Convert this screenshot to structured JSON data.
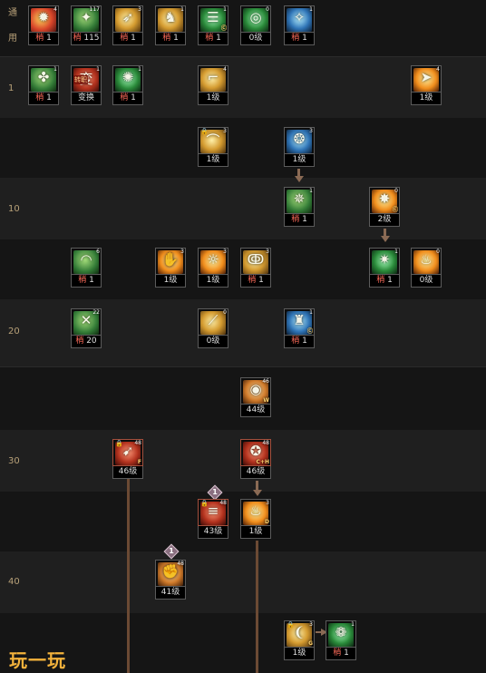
{
  "rows": [
    {
      "label": "通\n用",
      "vertical": true
    },
    {
      "label": "1"
    },
    {
      "label": ""
    },
    {
      "label": "10"
    },
    {
      "label": ""
    },
    {
      "label": "20"
    },
    {
      "label": ""
    },
    {
      "label": "30"
    },
    {
      "label": ""
    },
    {
      "label": "40"
    },
    {
      "label": ""
    }
  ],
  "skills": [
    {
      "name": "skill-fire-burst",
      "glyph": "✹",
      "grad": "g1",
      "count": "4",
      "red": "稍",
      "rest": " 1"
    },
    {
      "name": "skill-green-strike",
      "glyph": "✦",
      "grad": "g2",
      "count": "117",
      "red": "稍",
      "rest": " 115"
    },
    {
      "name": "skill-golden-leap",
      "glyph": "➶",
      "grad": "g3",
      "count": "3",
      "red": "稍",
      "rest": " 1"
    },
    {
      "name": "skill-golden-fall",
      "glyph": "♞",
      "grad": "g3",
      "count": "1",
      "red": "稍",
      "rest": " 1"
    },
    {
      "name": "skill-green-cloud",
      "glyph": "☰",
      "grad": "g4",
      "count": "1",
      "red": "稍",
      "rest": " 1",
      "sub": "Ⓒ"
    },
    {
      "name": "skill-green-target",
      "glyph": "◎",
      "grad": "g4",
      "count": "0",
      "plain": "0级"
    },
    {
      "name": "skill-blue-wings",
      "glyph": "✧",
      "grad": "g5",
      "count": "1",
      "red": "稍",
      "rest": " 1"
    },
    {
      "name": "skill-green-trap",
      "glyph": "✤",
      "grad": "g2",
      "count": "1",
      "red": "稍",
      "rest": " 1"
    },
    {
      "name": "skill-transform",
      "glyph": "変",
      "grad": "g8",
      "count": "1",
      "red": "",
      "rest": "变换",
      "tag": "转职"
    },
    {
      "name": "skill-green-spark",
      "glyph": "✺",
      "grad": "g4",
      "count": "1",
      "red": "稍",
      "rest": " 1"
    },
    {
      "name": "skill-golden-scythe",
      "glyph": "⌐",
      "grad": "g3",
      "count": "4",
      "plain": "1级"
    },
    {
      "name": "skill-golden-dash",
      "glyph": "➤",
      "grad": "g6",
      "count": "4",
      "plain": "1级"
    },
    {
      "name": "skill-golden-hook",
      "glyph": "⌒",
      "grad": "g3",
      "count": "3",
      "plain": "1级",
      "lock": true
    },
    {
      "name": "skill-blue-vortex",
      "glyph": "❂",
      "grad": "g5",
      "count": "3",
      "plain": "1级"
    },
    {
      "name": "skill-green-kick",
      "glyph": "✵",
      "grad": "g2",
      "count": "1",
      "red": "稍",
      "rest": " 1"
    },
    {
      "name": "skill-orange-aura",
      "glyph": "✸",
      "grad": "g6",
      "count": "0",
      "plain": "2级",
      "sub": "Ⓒ"
    },
    {
      "name": "skill-green-arc",
      "glyph": "◠",
      "grad": "g2",
      "count": "6",
      "red": "稍",
      "rest": " 1"
    },
    {
      "name": "skill-golden-palm",
      "glyph": "✋",
      "grad": "g6",
      "count": "3",
      "plain": "1级"
    },
    {
      "name": "skill-golden-crescent",
      "glyph": "☼",
      "grad": "g6",
      "count": "3",
      "plain": "1级"
    },
    {
      "name": "skill-golden-spiral",
      "glyph": "ↂ",
      "grad": "g3",
      "count": "3",
      "red": "稍",
      "rest": " 1"
    },
    {
      "name": "skill-green-flare",
      "glyph": "✷",
      "grad": "g4",
      "count": "1",
      "red": "稍",
      "rest": " 1"
    },
    {
      "name": "skill-fire-pillar",
      "glyph": "♨",
      "grad": "g6",
      "count": "0",
      "plain": "0级"
    },
    {
      "name": "skill-green-cross",
      "glyph": "✕",
      "grad": "g2",
      "count": "22",
      "red": "稍",
      "rest": " 20"
    },
    {
      "name": "skill-golden-slash",
      "glyph": "⟋",
      "grad": "g3",
      "count": "0",
      "plain": "0级"
    },
    {
      "name": "skill-blue-rush",
      "glyph": "♜",
      "grad": "g5",
      "count": "1",
      "red": "稍",
      "rest": " 1",
      "sub": "Ⓒ"
    },
    {
      "name": "skill-ring",
      "glyph": "◉",
      "grad": "g7",
      "count": "46",
      "plain": "44级",
      "sub": "W"
    },
    {
      "name": "skill-red-thrust",
      "glyph": "➹",
      "grad": "g8",
      "count": "48",
      "plain": "46级",
      "lock": true,
      "sub": "F",
      "red_border": true
    },
    {
      "name": "skill-flame-combo",
      "glyph": "✪",
      "grad": "g8",
      "count": "48",
      "plain": "46级",
      "sub": "C+H",
      "red_border": true
    },
    {
      "name": "skill-red-spears",
      "glyph": "≡",
      "grad": "g8",
      "count": "48",
      "plain": "43级",
      "lock": true,
      "red_border": true
    },
    {
      "name": "skill-fire-flicker",
      "glyph": "♨",
      "grad": "g6",
      "count": "3",
      "plain": "1级",
      "sub": "D"
    },
    {
      "name": "skill-golden-fist",
      "glyph": "✊",
      "grad": "g7",
      "count": "48",
      "plain": "41级"
    },
    {
      "name": "skill-golden-swipe",
      "glyph": "❨",
      "grad": "g3",
      "count": "3",
      "plain": "1级",
      "lock": true,
      "sub": "G"
    },
    {
      "name": "skill-green-swirl",
      "glyph": "❁",
      "grad": "g4",
      "count": "1",
      "red": "稍",
      "rest": " 1"
    }
  ],
  "requirements": [
    "1",
    "1"
  ],
  "watermark": "玩一玩"
}
